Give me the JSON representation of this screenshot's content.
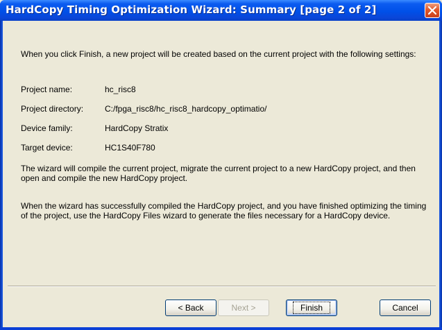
{
  "window": {
    "title": "HardCopy Timing Optimization Wizard: Summary [page 2 of 2]",
    "close_icon": "close-icon"
  },
  "summary": {
    "intro": "When you click Finish, a new project will be created based on the current project with the following settings:",
    "fields": [
      {
        "label": "Project name:",
        "value": "hc_risc8"
      },
      {
        "label": "Project directory:",
        "value": "C:/fpga_risc8/hc_risc8_hardcopy_optimatio/"
      },
      {
        "label": "Device family:",
        "value": "HardCopy Stratix"
      },
      {
        "label": "Target device:",
        "value": "HC1S40F780"
      }
    ],
    "para1": "The wizard will compile the current project, migrate the current project to a new HardCopy project, and then open and compile the new HardCopy project.",
    "para2": "When the wizard has successfully compiled the HardCopy project, and you have finished optimizing the timing of the project, use the HardCopy Files wizard to generate the files necessary for a HardCopy device."
  },
  "buttons": {
    "back": "< Back",
    "next": "Next >",
    "finish": "Finish",
    "cancel": "Cancel"
  },
  "colors": {
    "titlebar": "#0050e8",
    "dialog_bg": "#ece9d8",
    "close_button": "#e2582a"
  }
}
